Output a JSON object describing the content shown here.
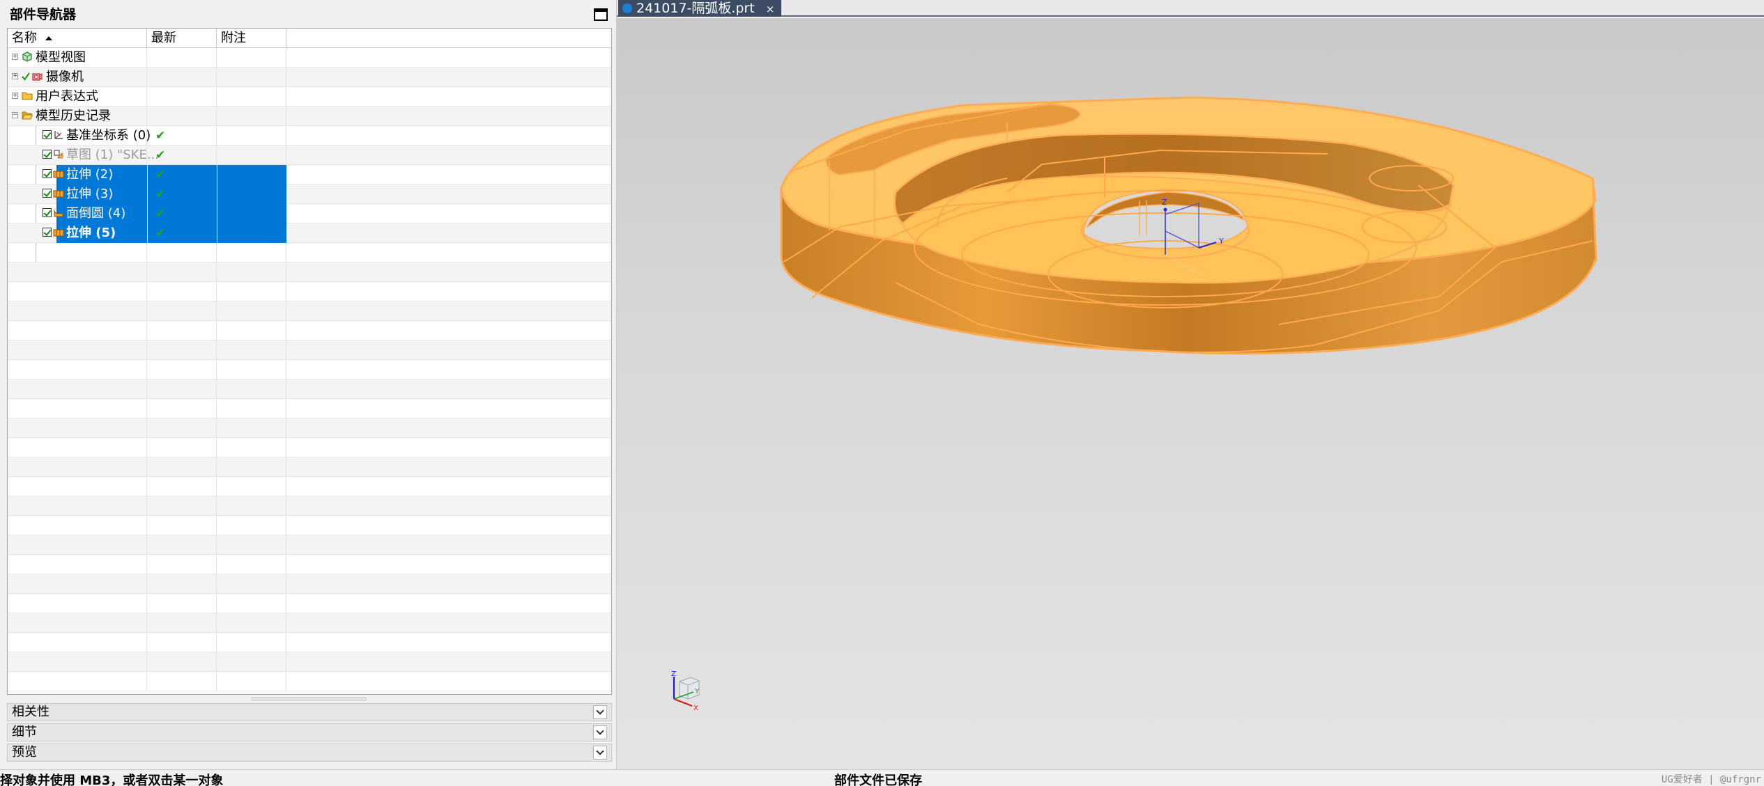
{
  "navigator": {
    "title": "部件导航器",
    "columns": {
      "name": "名称",
      "latest": "最新",
      "note": "附注"
    },
    "rows": [
      {
        "label": "模型视图",
        "icon": "model-views-icon"
      },
      {
        "label": "摄像机",
        "icon": "camera-icon"
      },
      {
        "label": "用户表达式",
        "icon": "folder-icon"
      },
      {
        "label": "模型历史记录",
        "icon": "open-folder-icon"
      },
      {
        "label": "基准坐标系 (0)",
        "icon": "datum-csys-icon",
        "latest": "✔"
      },
      {
        "label": "草图 (1) \"SKE...",
        "icon": "sketch-icon",
        "latest": "✔"
      },
      {
        "label": "拉伸 (2)",
        "icon": "extrude-icon",
        "latest": "✔"
      },
      {
        "label": "拉伸 (3)",
        "icon": "extrude-icon",
        "latest": "✔"
      },
      {
        "label": "面倒圆 (4)",
        "icon": "face-blend-icon",
        "latest": "✔"
      },
      {
        "label": "拉伸 (5)",
        "icon": "extrude-icon",
        "latest": "✔"
      }
    ],
    "sections": [
      "相关性",
      "细节",
      "预览"
    ]
  },
  "document_tab": {
    "label": "241017-隔弧板.prt",
    "close": "×"
  },
  "viewport": {
    "part_color": "#f7b24a",
    "axis_labels": {
      "z": "Z",
      "y": "Y",
      "x": "X"
    }
  },
  "status_bar": {
    "left": "择对象并使用 MB3，或者双击某一对象",
    "right": "部件文件已保存",
    "watermark": "UG爱好者 | @ufrgnr"
  }
}
